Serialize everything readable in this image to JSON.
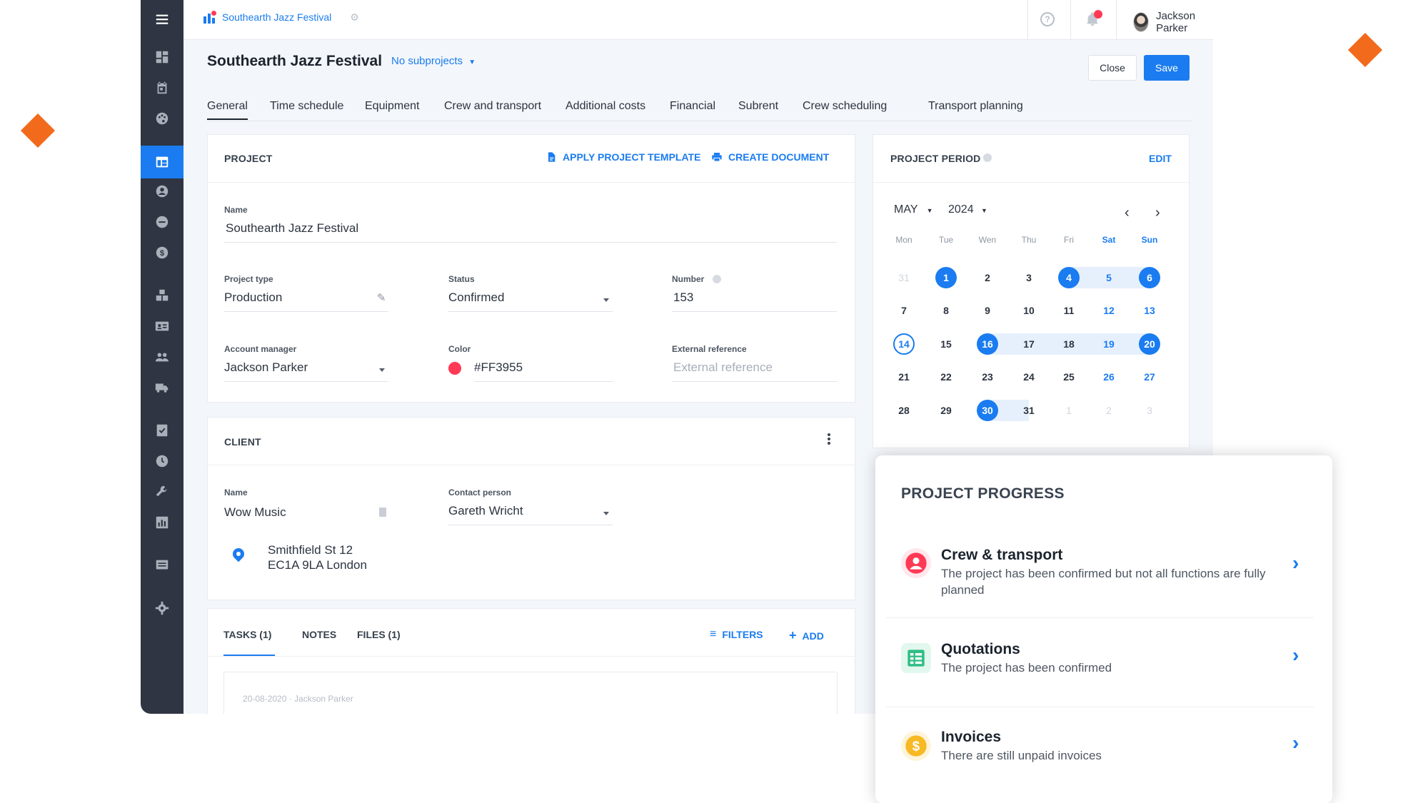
{
  "brand": {
    "app_name": "Southearth Jazz Festival"
  },
  "user": {
    "name": "Jackson Parker"
  },
  "page": {
    "title": "Southearth Jazz Festival",
    "subprojects": "No subprojects",
    "close_label": "Close",
    "save_label": "Save"
  },
  "tabs": [
    "General",
    "Time schedule",
    "Equipment",
    "Crew and transport",
    "Additional costs",
    "Financial",
    "Subrent",
    "Crew scheduling",
    "Transport planning"
  ],
  "project": {
    "section_title": "PROJECT",
    "apply_template": "APPLY PROJECT TEMPLATE",
    "create_document": "CREATE DOCUMENT",
    "name_label": "Name",
    "name_value": "Southearth Jazz Festival",
    "type_label": "Project type",
    "type_value": "Production",
    "status_label": "Status",
    "status_value": "Confirmed",
    "number_label": "Number",
    "number_value": "153",
    "manager_label": "Account manager",
    "manager_value": "Jackson Parker",
    "color_label": "Color",
    "color_value": "#FF3955",
    "external_label": "External reference",
    "external_placeholder": "External reference"
  },
  "client": {
    "section_title": "CLIENT",
    "name_label": "Name",
    "name_value": "Wow Music",
    "contact_label": "Contact person",
    "contact_value": "Gareth Wricht",
    "address_line1": "Smithfield St 12",
    "address_line2": "EC1A 9LA London"
  },
  "tasks": {
    "tab_tasks": "TASKS (1)",
    "tab_notes": "NOTES",
    "tab_files": "FILES (1)",
    "filters": "FILTERS",
    "add": "ADD",
    "entry_meta": "20-08-2020 · Jackson Parker"
  },
  "period": {
    "title": "PROJECT PERIOD",
    "edit": "EDIT",
    "month": "MAY",
    "year": "2024",
    "weekdays": [
      "Mon",
      "Tue",
      "Wen",
      "Thu",
      "Fri",
      "Sat",
      "Sun"
    ],
    "weeks": [
      [
        "31",
        "1",
        "2",
        "3",
        "4",
        "5",
        "6"
      ],
      [
        "7",
        "8",
        "9",
        "10",
        "11",
        "12",
        "13"
      ],
      [
        "14",
        "15",
        "16",
        "17",
        "18",
        "19",
        "20"
      ],
      [
        "21",
        "22",
        "23",
        "24",
        "25",
        "26",
        "27"
      ],
      [
        "28",
        "29",
        "30",
        "31",
        "1",
        "2",
        "3"
      ]
    ],
    "selected_days": [
      "1",
      "4",
      "6",
      "16",
      "20",
      "30"
    ],
    "today": "14"
  },
  "progress": {
    "title": "PROJECT PROGRESS",
    "items": [
      {
        "name": "Crew & transport",
        "desc": "The project has been confirmed but not all functions are fully planned",
        "icon": "person-icon",
        "color": "#ff3955"
      },
      {
        "name": "Quotations",
        "desc": "The project has been confirmed",
        "icon": "list-icon",
        "color": "#2ebd85"
      },
      {
        "name": "Invoices",
        "desc": "There are still unpaid invoices",
        "icon": "dollar-icon",
        "color": "#f7b924"
      }
    ]
  },
  "colors": {
    "accent": "#1a7cf0",
    "sidebar": "#2f3542",
    "brand_red": "#ff3955",
    "decor_orange": "#f26a1b"
  }
}
